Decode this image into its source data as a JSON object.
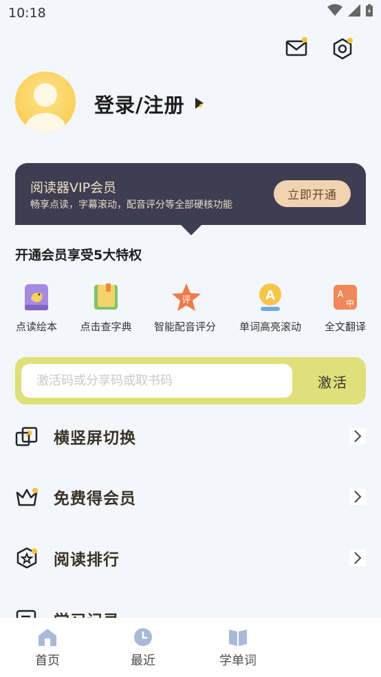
{
  "status_bar": {
    "time": "10:18"
  },
  "header": {
    "mail_icon": "mail-icon",
    "settings_icon": "settings-icon",
    "badge_color": "#f5c33b"
  },
  "profile": {
    "login_label": "登录/注册"
  },
  "vip": {
    "title": "阅读器VIP会员",
    "subtitle": "畅享点读，字幕滚动，配音评分等全部硬核功能",
    "button": "立即开通",
    "bg_color": "#3f3d52",
    "button_color": "#f1d3b1"
  },
  "privileges": {
    "title": "开通会员享受5大特权",
    "items": [
      {
        "label": "点读绘本",
        "icon": "picture-book-icon"
      },
      {
        "label": "点击查字典",
        "icon": "dictionary-icon"
      },
      {
        "label": "智能配音评分",
        "icon": "star-score-icon"
      },
      {
        "label": "单词高亮滚动",
        "icon": "word-highlight-icon"
      },
      {
        "label": "全文翻译",
        "icon": "translate-icon"
      }
    ]
  },
  "activation": {
    "placeholder": "激活码或分享码或取书码",
    "button": "激活",
    "bg_color": "#dfe079"
  },
  "menu": [
    {
      "label": "横竖屏切换",
      "icon": "screen-rotate-icon"
    },
    {
      "label": "免费得会员",
      "icon": "crown-icon"
    },
    {
      "label": "阅读排行",
      "icon": "ranking-icon"
    },
    {
      "label": "学习记录",
      "icon": "record-icon"
    }
  ],
  "bottom_nav": {
    "items": [
      {
        "label": "首页",
        "icon": "home-icon"
      },
      {
        "label": "最近",
        "icon": "clock-icon"
      },
      {
        "label": "学单词",
        "icon": "book-icon"
      }
    ]
  }
}
